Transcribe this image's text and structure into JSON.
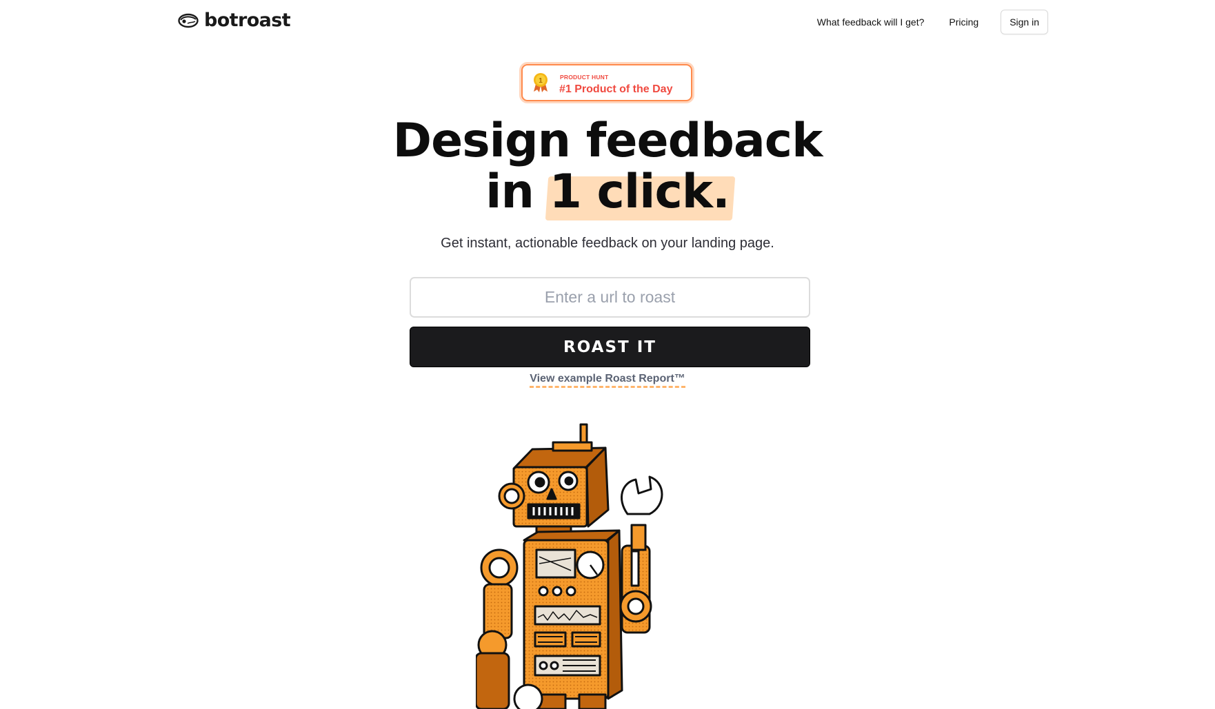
{
  "header": {
    "brand": "botroast",
    "nav": {
      "feedback_link": "What feedback will I get?",
      "pricing_link": "Pricing",
      "signin_button": "Sign in"
    }
  },
  "badge": {
    "medal_number": "1",
    "small_label": "PRODUCT HUNT",
    "main_label": "#1 Product of the Day"
  },
  "hero": {
    "title_line1": "Design feedback",
    "title_line2_prefix": "in ",
    "title_line2_highlight": "1 click.",
    "subtitle": "Get instant, actionable feedback on your landing page."
  },
  "form": {
    "url_placeholder": "Enter a url to roast",
    "url_value": "",
    "submit_label": "ROAST IT",
    "example_link": "View example Roast Report™"
  },
  "colors": {
    "accent_orange": "#f59a2c",
    "badge_red": "#f04a40",
    "highlight": "#ffdcb8",
    "button_dark": "#1b1b1d"
  }
}
